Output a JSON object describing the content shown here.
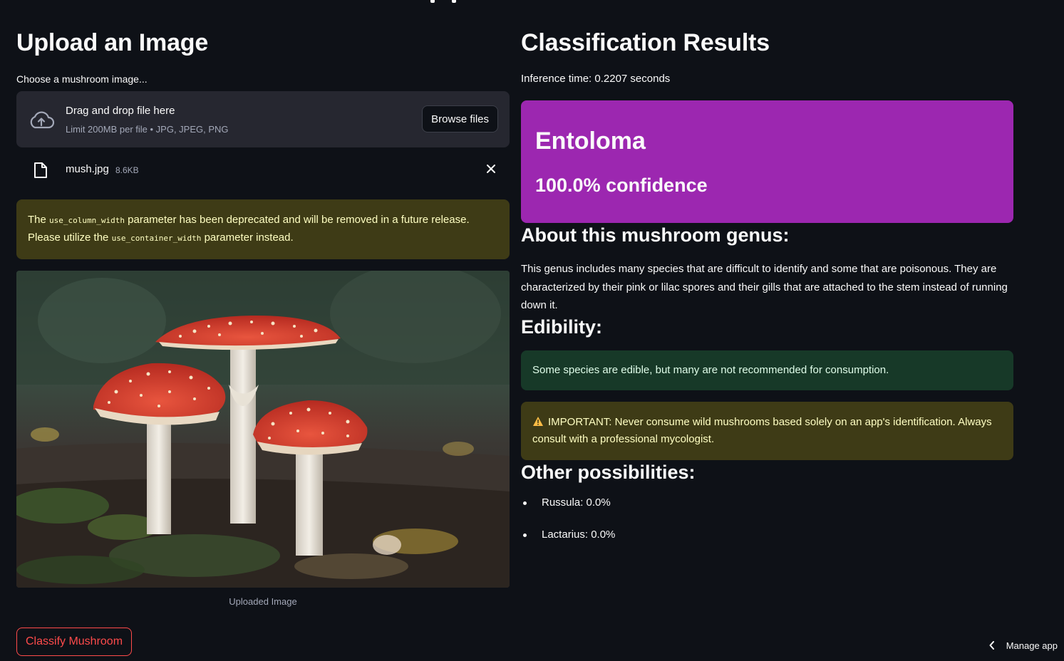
{
  "left": {
    "heading": "Upload an Image",
    "uploader_label": "Choose a mushroom image...",
    "dropzone_title": "Drag and drop file here",
    "dropzone_limit": "Limit 200MB per file • JPG, JPEG, PNG",
    "browse_label": "Browse files",
    "file_name": "mush.jpg",
    "file_size": "8.6KB",
    "deprecation": {
      "t1": "The ",
      "code1": "use_column_width",
      "t2": " parameter has been deprecated and will be removed in a future release. Please utilize the ",
      "code2": "use_container_width",
      "t3": " parameter instead."
    },
    "image_caption": "Uploaded Image",
    "classify_label": "Classify Mushroom"
  },
  "right": {
    "heading": "Classification Results",
    "inference": "Inference time: 0.2207 seconds",
    "genus": "Entoloma",
    "confidence": "100.0% confidence",
    "about_title": "About this mushroom genus:",
    "about_text": "This genus includes many species that are difficult to identify and some that are poisonous. They are characterized by their pink or lilac spores and their gills that are attached to the stem instead of running down it.",
    "edibility_title": "Edibility:",
    "edibility_text": "Some species are edible, but many are not recommended for consumption.",
    "important_text": "IMPORTANT: Never consume wild mushrooms based solely on an app's identification. Always consult with a professional mycologist.",
    "other_title": "Other possibilities:",
    "possibilities": [
      "Russula: 0.0%",
      "Lactarius: 0.0%"
    ]
  },
  "footer": {
    "manage_app": "Manage app"
  },
  "colors": {
    "background": "#0e1117",
    "result_card": "#9c27b0",
    "primary": "#ff4b4b",
    "warning_bg": "#3e3b16",
    "success_bg": "#173928"
  }
}
